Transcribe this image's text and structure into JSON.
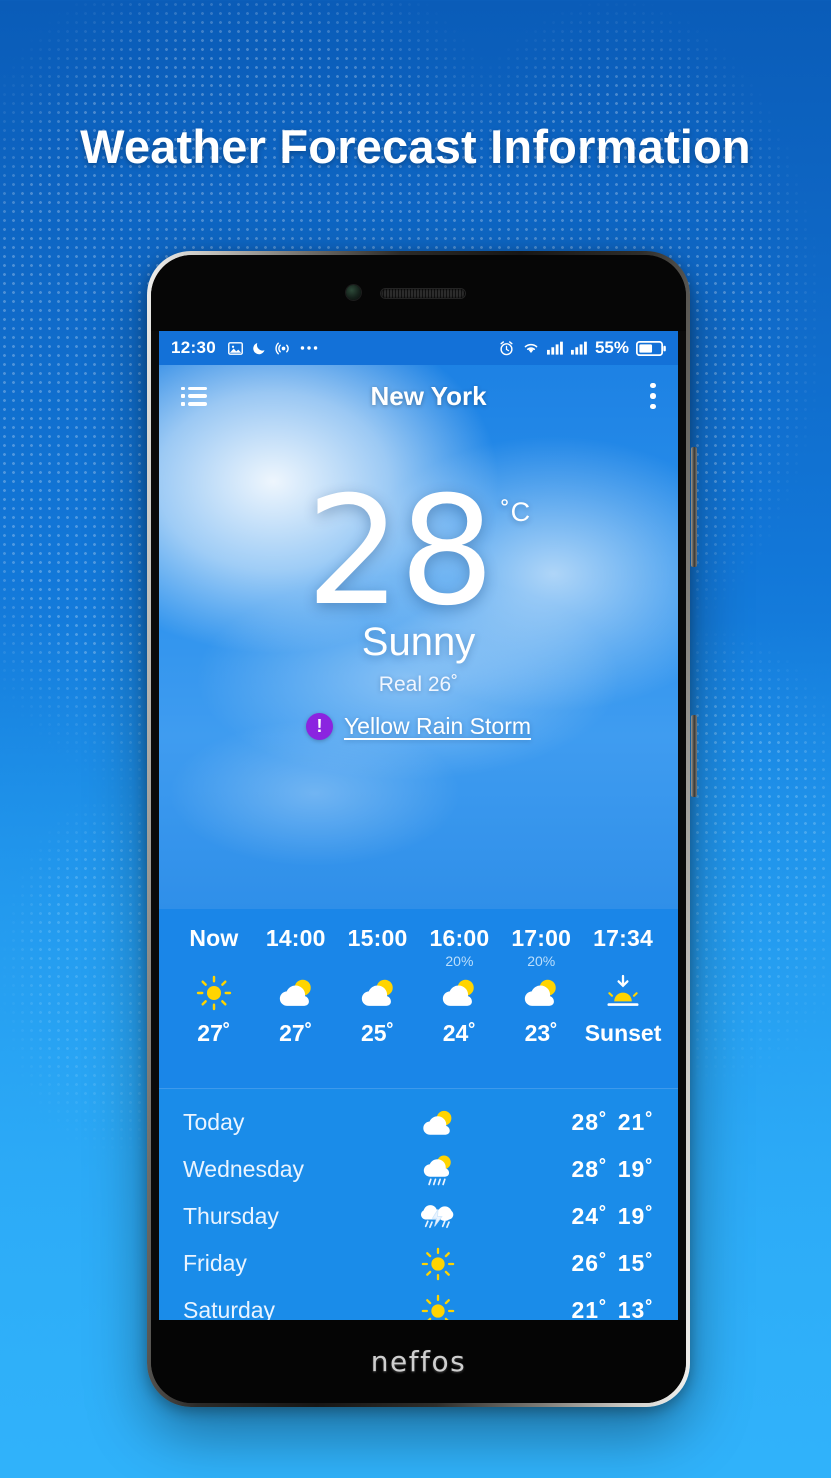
{
  "headline": "Weather Forecast Information",
  "phone": {
    "brand": "neffos"
  },
  "statusbar": {
    "time": "12:30",
    "battery_percent": "55%",
    "left_icons": [
      "image-icon",
      "moon-icon",
      "hotspot-icon",
      "more-icon"
    ],
    "right_icons": [
      "alarm-icon",
      "wifi-icon",
      "signal-icon",
      "signal-icon",
      "battery-icon"
    ]
  },
  "appbar": {
    "menu_icon": "list-icon",
    "title": "New York",
    "overflow_icon": "more-vertical-icon"
  },
  "current": {
    "temperature": "28",
    "unit": "˚C",
    "condition": "Sunny",
    "feels_like": "Real 26˚",
    "alert_badge": "!",
    "alert_text": "Yellow Rain Storm",
    "alert_color": "#8b24e0"
  },
  "hourly": [
    {
      "time": "Now",
      "pop": "",
      "icon": "sunny",
      "temp": "27˚"
    },
    {
      "time": "14:00",
      "pop": "",
      "icon": "partly-cloudy",
      "temp": "27˚"
    },
    {
      "time": "15:00",
      "pop": "",
      "icon": "partly-cloudy",
      "temp": "25˚"
    },
    {
      "time": "16:00",
      "pop": "20%",
      "icon": "partly-cloudy",
      "temp": "24˚"
    },
    {
      "time": "17:00",
      "pop": "20%",
      "icon": "partly-cloudy",
      "temp": "23˚"
    },
    {
      "time": "17:34",
      "pop": "",
      "icon": "sunset",
      "temp": "Sunset"
    }
  ],
  "daily": [
    {
      "day": "Today",
      "icon": "partly-cloudy",
      "high": "28˚",
      "low": "21˚"
    },
    {
      "day": "Wednesday",
      "icon": "cloud-rain-sun",
      "high": "28˚",
      "low": "19˚"
    },
    {
      "day": "Thursday",
      "icon": "thunderstorm",
      "high": "24˚",
      "low": "19˚"
    },
    {
      "day": "Friday",
      "icon": "sunny",
      "high": "26˚",
      "low": "15˚"
    },
    {
      "day": "Saturday",
      "icon": "sunny",
      "high": "21˚",
      "low": "13˚"
    }
  ],
  "colors": {
    "background_top": "#0a5cb8",
    "background_bottom": "#33b2fa",
    "panel": "#1a86e8",
    "accent_sun": "#ffd400",
    "alert": "#8b24e0"
  }
}
